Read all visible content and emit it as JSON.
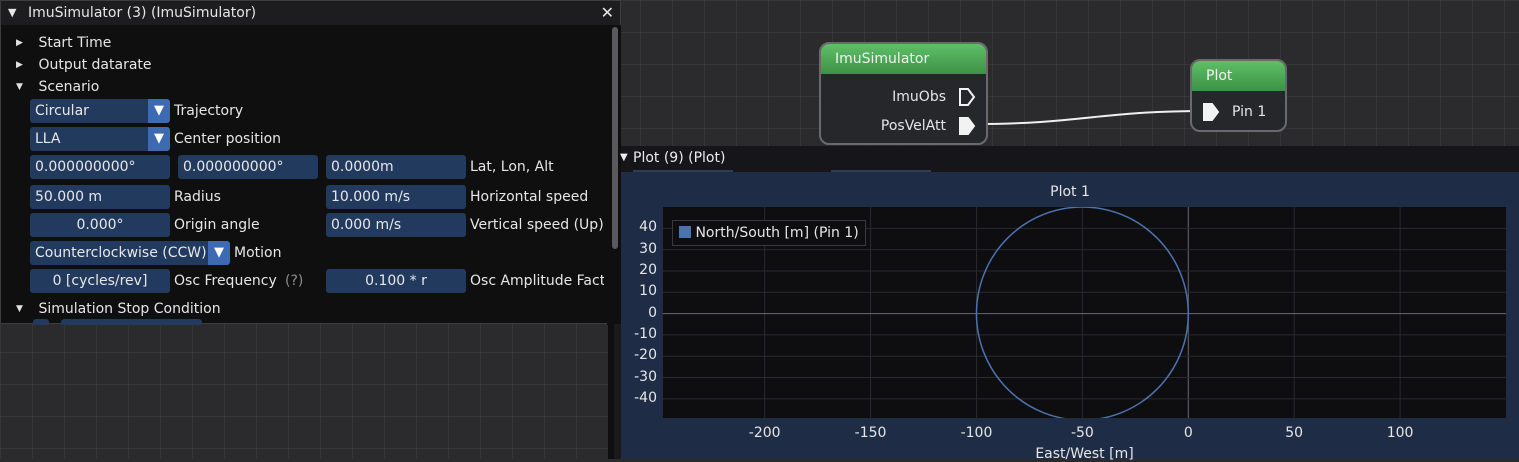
{
  "imu_window": {
    "title": "ImuSimulator (3) (ImuSimulator)",
    "close_label": "✕",
    "sections": {
      "start_time": "Start Time",
      "output_datarate": "Output datarate",
      "scenario": "Scenario",
      "stop_condition": "Simulation Stop Condition"
    },
    "trajectory": {
      "value": "Circular",
      "label": "Trajectory"
    },
    "center_position": {
      "value": "LLA",
      "label": "Center position"
    },
    "lat": "0.000000000°",
    "lon": "0.000000000°",
    "alt": "0.0000m",
    "lla_label": "Lat, Lon, Alt",
    "radius": {
      "value": "50.000 m",
      "label": "Radius"
    },
    "horizontal_speed": {
      "value": "10.000 m/s",
      "label": "Horizontal speed"
    },
    "origin_angle": {
      "value": "0.000°",
      "label": "Origin angle"
    },
    "vertical_speed": {
      "value": "0.000 m/s",
      "label": "Vertical speed (Up)"
    },
    "motion": {
      "value": "Counterclockwise (CCW)",
      "label": "Motion"
    },
    "osc_frequency": {
      "value": "0 [cycles/rev]",
      "label": "Osc Frequency",
      "help": "(?)"
    },
    "osc_amplitude": {
      "value": "0.100 * r",
      "label": "Osc Amplitude Fact"
    }
  },
  "nodes": {
    "imu_simulator": {
      "title": "ImuSimulator",
      "pin_imuobs": "ImuObs",
      "pin_posvelatt": "PosVelAtt"
    },
    "plot": {
      "title": "Plot",
      "pin_1": "Pin 1"
    }
  },
  "plot_window": {
    "title": "Plot (9) (Plot)"
  },
  "chart_data": {
    "type": "line",
    "title": "Plot 1",
    "xlabel": "East/West [m]",
    "ylabel": "",
    "legend": [
      "North/South [m] (Pin 1)"
    ],
    "legend_placement": "top-left",
    "series": [
      {
        "name": "North/South [m] (Pin 1)",
        "shape": "circle",
        "center": [
          -50,
          0
        ],
        "radius": 50,
        "color": "#4c72b0"
      }
    ],
    "xlim": [
      -248,
      150
    ],
    "ylim": [
      -49,
      50
    ],
    "x_ticks": [
      -200,
      -150,
      -100,
      -50,
      0,
      50,
      100
    ],
    "y_ticks": [
      40,
      30,
      20,
      10,
      0,
      -10,
      -20,
      -30,
      -40
    ],
    "grid": true
  }
}
